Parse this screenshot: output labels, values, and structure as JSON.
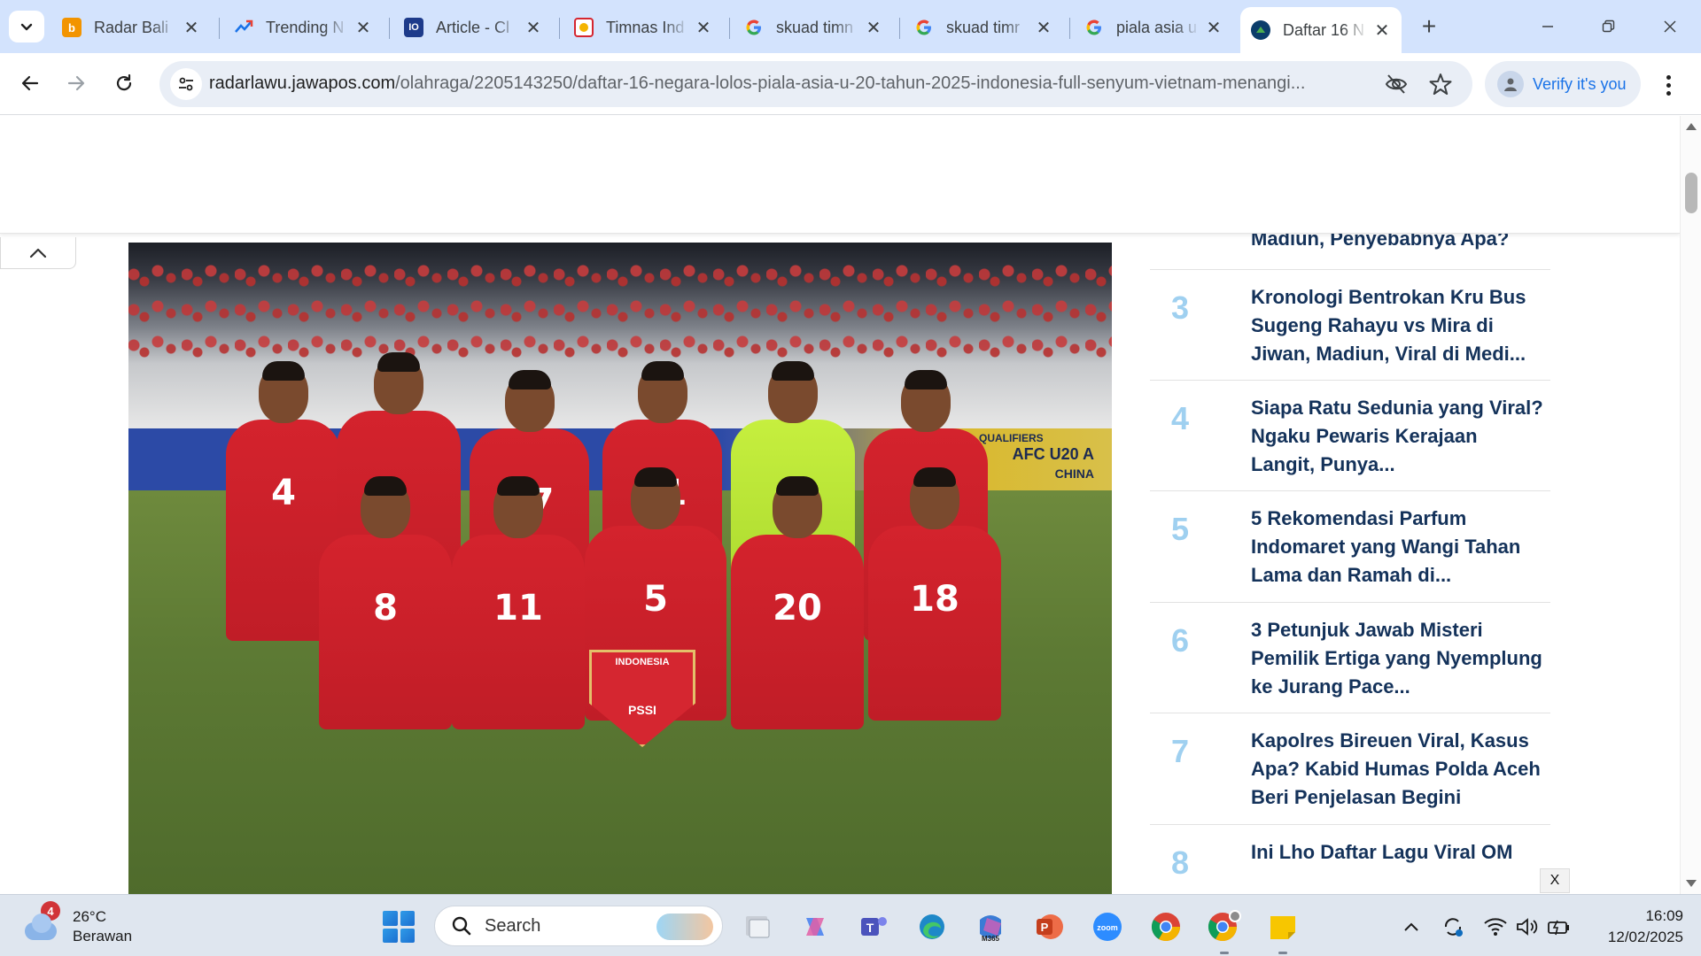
{
  "browser": {
    "tabs": [
      {
        "title": "Radar Bali",
        "favicon": "radarbali-b-icon",
        "active": false
      },
      {
        "title": "Trending N",
        "favicon": "trending-line-icon",
        "active": false
      },
      {
        "title": "Article - Cl",
        "favicon": "article-logo-icon",
        "active": false
      },
      {
        "title": "Timnas Ind",
        "favicon": "timnas-icon",
        "active": false
      },
      {
        "title": "skuad timn",
        "favicon": "google-g-icon",
        "active": false
      },
      {
        "title": "skuad timr",
        "favicon": "google-g-icon",
        "active": false
      },
      {
        "title": "piala asia u",
        "favicon": "google-g-icon",
        "active": false
      },
      {
        "title": "Daftar 16 N",
        "favicon": "jawapos-icon",
        "active": true
      }
    ],
    "close_symbol": "✕",
    "new_tab_symbol": "+",
    "url_host": "radarlawu.jawapos.com",
    "url_path": "/olahraga/2205143250/daftar-16-negara-lolos-piala-asia-u-20-tahun-2025-indonesia-full-senyum-vietnam-menangi...",
    "verify_label": "Verify it's you"
  },
  "photo": {
    "board_text_line1": "AFC U20 A",
    "board_text_line2": "CHINA",
    "board_left_text": "QUALIFIERS",
    "pennant_text": "INDONESIA",
    "pennant_sub": "PSSI",
    "jersey_numbers": [
      "4",
      "",
      "17",
      "21",
      "",
      "",
      "8",
      "11",
      "5",
      "20",
      "18"
    ]
  },
  "popular": {
    "items": [
      {
        "rank": "",
        "title": "Madiun, Penyebabnya Apa?"
      },
      {
        "rank": "3",
        "title": "Kronologi Bentrokan Kru Bus Sugeng Rahayu vs Mira di Jiwan, Madiun, Viral di Medi..."
      },
      {
        "rank": "4",
        "title": "Siapa Ratu Sedunia yang Viral? Ngaku Pewaris Kerajaan Langit, Punya..."
      },
      {
        "rank": "5",
        "title": "5 Rekomendasi Parfum Indomaret yang Wangi Tahan Lama dan Ramah di..."
      },
      {
        "rank": "6",
        "title": "3 Petunjuk Jawab Misteri Pemilik Ertiga yang Nyemplung ke Jurang Pace..."
      },
      {
        "rank": "7",
        "title": "Kapolres Bireuen Viral, Kasus Apa? Kabid Humas Polda Aceh Beri Penjelasan Begini"
      },
      {
        "rank": "8",
        "title": "Ini Lho Daftar Lagu Viral OM"
      }
    ],
    "close_label": "X"
  },
  "taskbar": {
    "weather_badge": "4",
    "temperature": "26°C",
    "condition": "Berawan",
    "search_placeholder": "Search",
    "apps": [
      "file-explorer-icon",
      "copilot-icon",
      "teams-icon",
      "edge-icon",
      "m365-icon",
      "powerpoint-icon",
      "zoom-icon",
      "chrome-icon",
      "chrome-profile-icon",
      "sticky-notes-icon"
    ],
    "m365_label": "M365",
    "zoom_label": "zoom",
    "time": "16:09",
    "date": "12/02/2025"
  }
}
